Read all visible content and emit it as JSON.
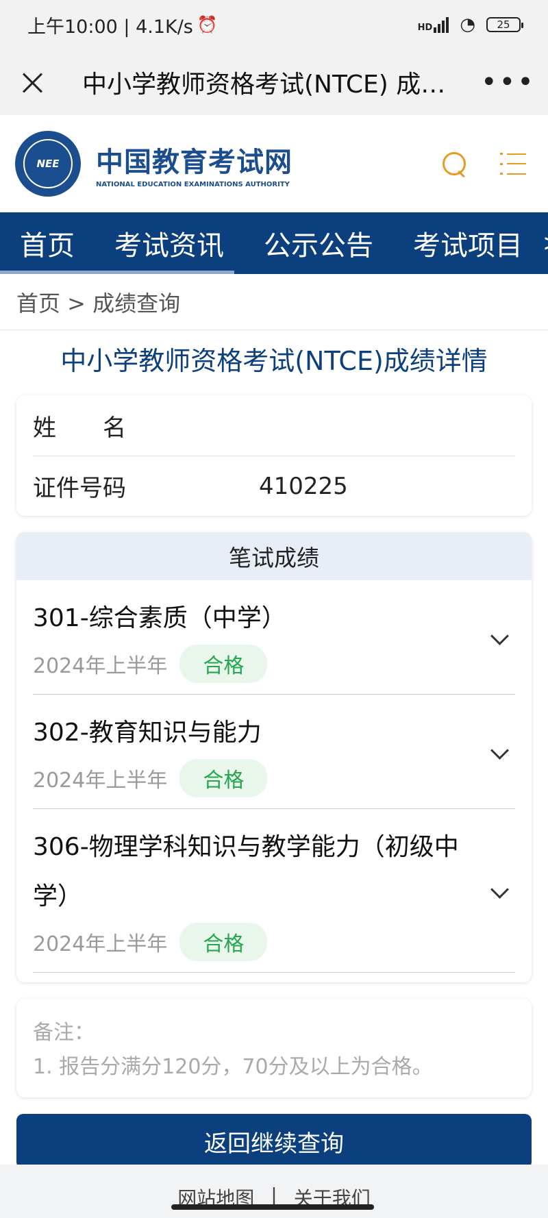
{
  "status_bar": {
    "time_speed": "上午10:00 | 4.1K/s",
    "alarm_icon": "⏰",
    "signal": "HD",
    "battery": "25"
  },
  "title_bar": {
    "title": "中小学教师资格考试(NTCE) 成…",
    "more": "•••"
  },
  "site": {
    "logo_emblem": "NEE",
    "logo_cn": "中国教育考试网",
    "logo_en": "NATIONAL EDUCATION EXAMINATIONS AUTHORITY"
  },
  "nav": {
    "items": [
      "首页",
      "考试资讯",
      "公示公告",
      "考试项目"
    ],
    "arrow": ">"
  },
  "breadcrumb": "首页 > 成绩查询",
  "detail_title": "中小学教师资格考试(NTCE)成绩详情",
  "info": {
    "name_label": "姓　　名",
    "name_value": "",
    "id_label": "证件号码",
    "id_value": "410225"
  },
  "scores": {
    "header": "笔试成绩",
    "items": [
      {
        "subject": "301-综合素质（中学）",
        "period": "2024年上半年",
        "status": "合格"
      },
      {
        "subject": "302-教育知识与能力",
        "period": "2024年上半年",
        "status": "合格"
      },
      {
        "subject": "306-物理学科知识与教学能力（初级中学）",
        "period": "2024年上半年",
        "status": "合格"
      }
    ]
  },
  "notes": {
    "label": "备注：",
    "text": "1. 报告分满分120分，70分及以上为合格。"
  },
  "back_button": "返回继续查询",
  "footer": {
    "sitemap": "网站地图",
    "separator": "|",
    "about": "关于我们"
  },
  "colors": {
    "brand_blue": "#0b3f7d",
    "accent_orange": "#e69b22",
    "pass_green": "#27a651"
  }
}
